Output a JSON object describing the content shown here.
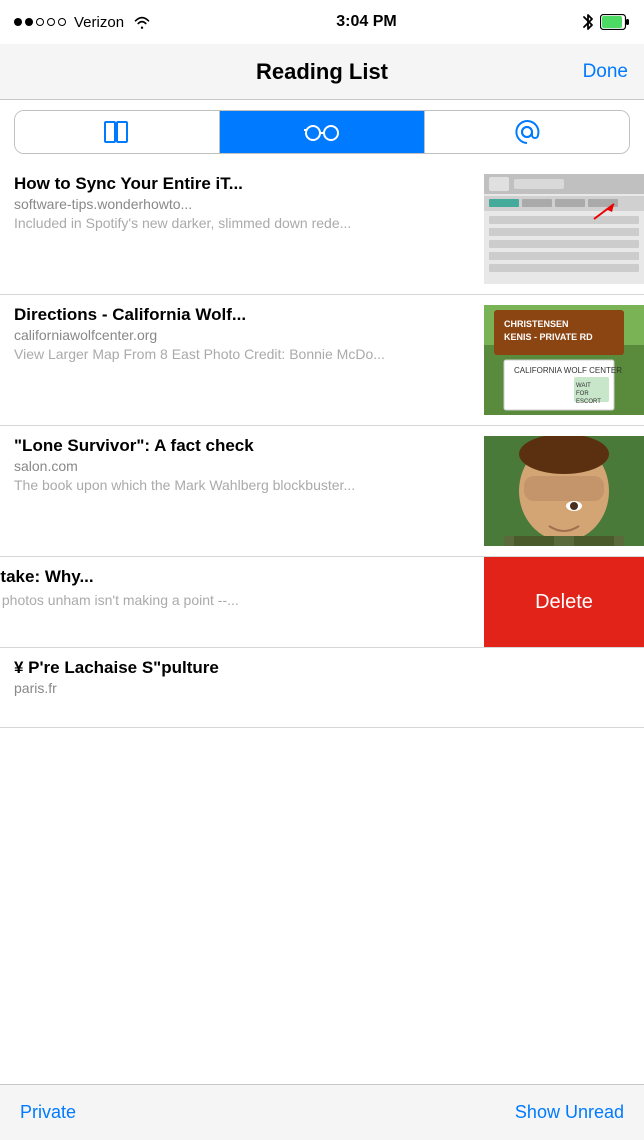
{
  "statusBar": {
    "dots": [
      "filled",
      "filled",
      "empty",
      "empty",
      "empty"
    ],
    "carrier": "Verizon",
    "time": "3:04 PM",
    "bluetooth": "BT",
    "battery": "Battery"
  },
  "navBar": {
    "title": "Reading List",
    "doneLabel": "Done"
  },
  "tabs": [
    {
      "id": "bookmarks",
      "label": "Bookmarks",
      "active": false
    },
    {
      "id": "reading-list",
      "label": "Reading List",
      "active": true
    },
    {
      "id": "shared-links",
      "label": "Shared Links",
      "active": false
    }
  ],
  "articles": [
    {
      "id": "itunes",
      "title": "How to Sync Your Entire iT...",
      "url": "software-tips.wonderhowto...",
      "desc": "Included in Spotify's new darker, slimmed down rede...",
      "hasThumb": true,
      "thumbType": "screenshot"
    },
    {
      "id": "wolf",
      "title": "Directions - California Wolf...",
      "url": "californiawolfcenter.org",
      "desc": "View Larger Map From 8 East Photo Credit: Bonnie McDo...",
      "hasThumb": true,
      "thumbType": "sign"
    },
    {
      "id": "lone-survivor",
      "title": "\"Lone Survivor\": A fact check",
      "url": "salon.com",
      "desc": "The book upon which the Mark Wahlberg blockbuster...",
      "hasThumb": true,
      "thumbType": "person"
    },
    {
      "id": "lena",
      "title": "Lena Dunham mistake: Why...",
      "url": "",
      "desc": "bounty for unretouched photos unham isn't making a point --...",
      "hasThumb": false,
      "shifted": true
    },
    {
      "id": "paris",
      "title": "¥ P're Lachaise S\"pulture",
      "url": "paris.fr",
      "desc": "",
      "hasThumb": false
    }
  ],
  "deleteLabel": "Delete",
  "bottomBar": {
    "privateLabel": "Private",
    "showUnreadLabel": "Show Unread"
  }
}
